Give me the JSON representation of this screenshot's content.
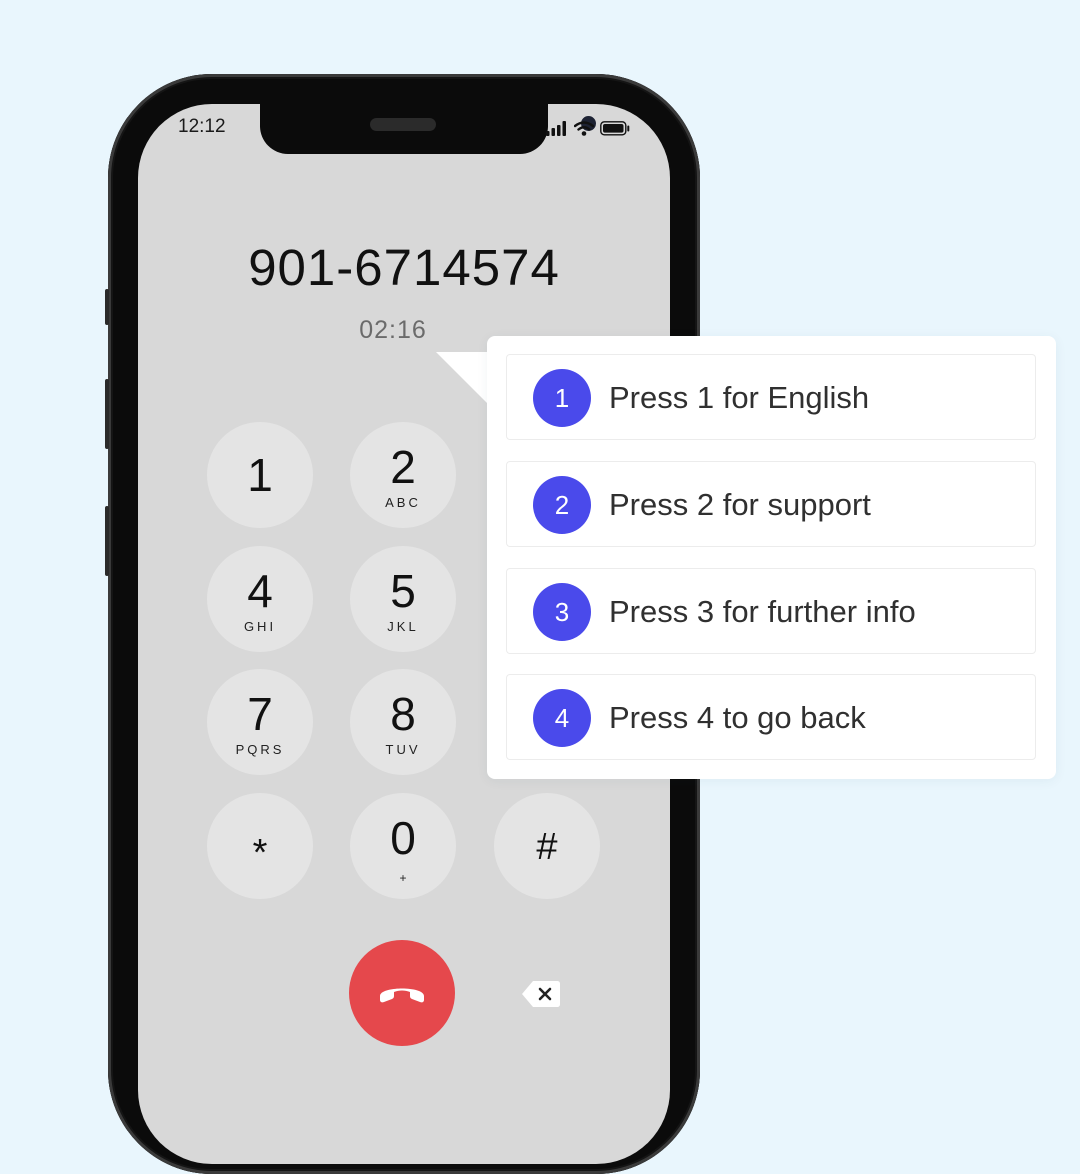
{
  "status_bar": {
    "time": "12:12",
    "icons": [
      "signal-bars-icon",
      "wifi-icon",
      "battery-icon"
    ]
  },
  "call": {
    "number": "901-6714574",
    "duration": "02:16"
  },
  "keypad": {
    "keys": [
      {
        "digit": "1",
        "letters": ""
      },
      {
        "digit": "2",
        "letters": "ABC"
      },
      {
        "digit": "4",
        "letters": "GHI"
      },
      {
        "digit": "5",
        "letters": "JKL"
      },
      {
        "digit": "7",
        "letters": "PQRS"
      },
      {
        "digit": "8",
        "letters": "TUV"
      },
      {
        "symbol": "*"
      },
      {
        "digit": "0",
        "sub": "+"
      },
      {
        "symbol": "#"
      }
    ],
    "end_call_icon": "phone-hangup-icon",
    "delete_icon": "backspace-icon"
  },
  "ivr_menu": {
    "options": [
      {
        "number": "1",
        "text": "Press 1 for English"
      },
      {
        "number": "2",
        "text": "Press 2 for support"
      },
      {
        "number": "3",
        "text": "Press 3 for further info"
      },
      {
        "number": "4",
        "text": "Press 4 to go back"
      }
    ]
  },
  "colors": {
    "background": "#e9f6fd",
    "screen": "#d8d8d8",
    "key": "#e4e4e4",
    "end_call": "#e5484c",
    "badge": "#4a4aeb"
  }
}
